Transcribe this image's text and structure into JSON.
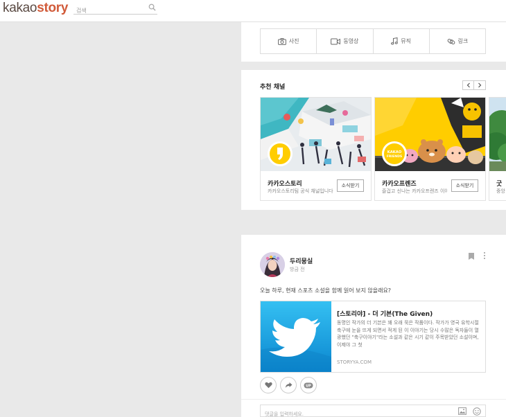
{
  "header": {
    "logo_part1": "kakao",
    "logo_part2": "story",
    "search_placeholder": "검색"
  },
  "write_tools": [
    "사진",
    "동영상",
    "뮤직",
    "링크"
  ],
  "channels": {
    "title": "추천 채널",
    "cards": [
      {
        "name": "카카오스토리",
        "desc": "카카오스토리팀 공식 채널입니다",
        "button": "소식받기"
      },
      {
        "name": "카카오프렌즈",
        "desc": "즐겁고 신나는 카카오프렌즈 이야기",
        "button": "소식받기"
      },
      {
        "name": "굿",
        "desc": "중앙"
      }
    ]
  },
  "post": {
    "author": "두리뭉실",
    "time": "방금 전",
    "text": "오늘 하루, 현재 스포츠 소설을 함께 읽어 보지 않을래요?",
    "link": {
      "title": "[스토리야] - 더 기븐(The Given)",
      "desc": "동명인 작가의 더 기븐은 꽤 오래 묵은 작품이다. 작가가 영국 유학시절 축구에 눈을 뜨게 되면서 적게 된 이 이야기는 당시 수많은 독자들이 열광했던 \"축구이야기\"라는 소설과 같은 시기 같이 주목받았던 소설이며, 이제야 그 첫",
      "url": "STORYYA.COM"
    },
    "share_badge": "UP",
    "comment_placeholder": "댓글을 입력하세요."
  },
  "colors": {
    "logo_brown": "#5a4a43",
    "logo_accent": "#d15b3a",
    "kakao_yellow": "#ffcd00",
    "twitter_blue": "#1da6ea"
  }
}
